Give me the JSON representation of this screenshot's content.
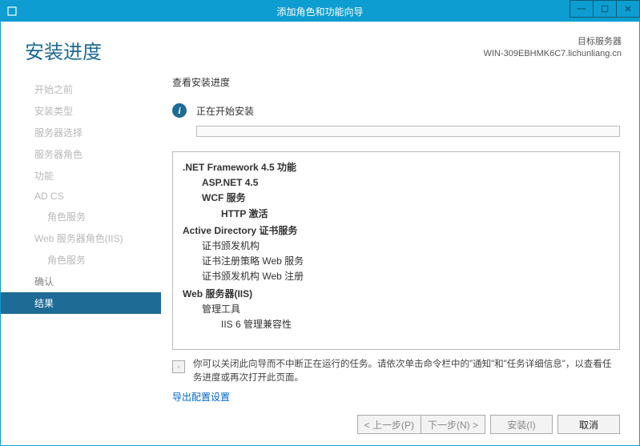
{
  "titlebar": {
    "title": "添加角色和功能向导"
  },
  "header": {
    "title": "安装进度",
    "target_label": "目标服务器",
    "target_value": "WIN-309EBHMK6C7.lichunliang.cn"
  },
  "sidebar": {
    "items": [
      {
        "label": "开始之前",
        "class": ""
      },
      {
        "label": "安装类型",
        "class": ""
      },
      {
        "label": "服务器选择",
        "class": ""
      },
      {
        "label": "服务器角色",
        "class": ""
      },
      {
        "label": "功能",
        "class": ""
      },
      {
        "label": "AD CS",
        "class": ""
      },
      {
        "label": "角色服务",
        "class": "sub"
      },
      {
        "label": "Web 服务器角色(IIS)",
        "class": ""
      },
      {
        "label": "角色服务",
        "class": "sub"
      },
      {
        "label": "确认",
        "class": "ok"
      },
      {
        "label": "结果",
        "class": "active"
      }
    ]
  },
  "main": {
    "section_label": "查看安装进度",
    "status_text": "正在开始安装",
    "features": [
      {
        "text": ".NET Framework 4.5 功能",
        "cls": "l0"
      },
      {
        "text": "ASP.NET 4.5",
        "cls": "l1"
      },
      {
        "text": "WCF 服务",
        "cls": "l1"
      },
      {
        "text": "HTTP 激活",
        "cls": "l2"
      },
      {
        "text": "Active Directory 证书服务",
        "cls": "l0"
      },
      {
        "text": "证书颁发机构",
        "cls": "l1 n"
      },
      {
        "text": "证书注册策略 Web 服务",
        "cls": "l1 n"
      },
      {
        "text": "证书颁发机构 Web 注册",
        "cls": "l1 n"
      },
      {
        "text": "Web 服务器(IIS)",
        "cls": "l0"
      },
      {
        "text": "管理工具",
        "cls": "l1 n"
      },
      {
        "text": "IIS 6 管理兼容性",
        "cls": "l2 n"
      }
    ],
    "note": "你可以关闭此向导而不中断正在运行的任务。请依次单击命令栏中的\"通知\"和\"任务详细信息\"，以查看任务进度或再次打开此页面。",
    "export_link": "导出配置设置"
  },
  "footer": {
    "prev": "< 上一步(P)",
    "next": "下一步(N) >",
    "install": "安装(I)",
    "cancel": "取消"
  }
}
